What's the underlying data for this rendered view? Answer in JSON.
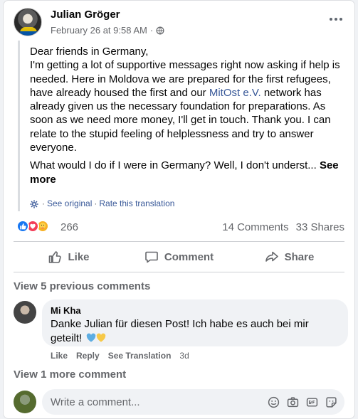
{
  "post": {
    "author": "Julian Gröger",
    "date": "February 26 at 9:58 AM",
    "dot": "·",
    "greeting": "Dear friends in Germany,",
    "text_part1": "I'm getting a lot of supportive messages right now asking if help is needed. Here in Moldova we are prepared for the first refugees, have already housed the first and our ",
    "link_text": "MitOst e.V.",
    "text_part2": " network has already given us the necessary foundation for preparations. As soon as we need more money, I'll get in touch. Thank you. I can relate to the stupid feeling of helplessness and try to answer everyone.",
    "teaser": "What would I do if I were in Germany? Well, I don't underst... ",
    "see_more": "See more",
    "see_original": "See original",
    "separator": "·",
    "rate_translation": "Rate this translation"
  },
  "stats": {
    "reaction_count": "266",
    "comments": "14 Comments",
    "shares": "33 Shares"
  },
  "actions": {
    "like": "Like",
    "comment": "Comment",
    "share": "Share"
  },
  "comments_section": {
    "view_previous": "View 5 previous comments",
    "view_more": "View 1 more comment"
  },
  "comment": {
    "author": "Mi Kha",
    "text": "Danke Julian für diesen Post! Ich habe es auch bei mir geteilt! ",
    "like": "Like",
    "reply": "Reply",
    "see_translation": "See Translation",
    "age": "3d"
  },
  "composer": {
    "placeholder": "Write a comment..."
  },
  "colors": {
    "link": "#385898",
    "secondary_text": "#65676b",
    "like_blue": "#1877f2",
    "love_red": "#f33e58",
    "care_yellow": "#f7b125"
  },
  "icons": [
    "globe-icon",
    "more-options-icon",
    "gear-icon",
    "like-reaction-icon",
    "love-reaction-icon",
    "care-reaction-icon",
    "like-icon",
    "comment-icon",
    "share-icon",
    "blue-heart-icon",
    "yellow-heart-icon",
    "emoji-icon",
    "camera-icon",
    "gif-icon",
    "sticker-icon"
  ]
}
